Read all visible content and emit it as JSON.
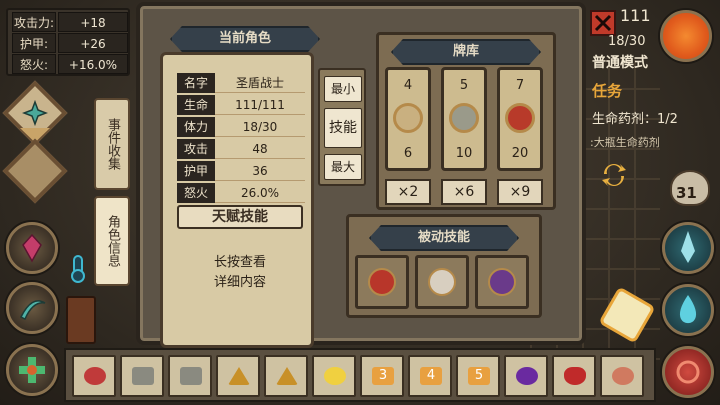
{
  "hud": {
    "attack_label": "攻击力:",
    "attack_value": "+18",
    "armor_label": "护甲:",
    "armor_value": "+26",
    "rage_label": "怒火:",
    "rage_value": "+16.0%"
  },
  "side_tabs": {
    "events": "事件收集",
    "character": "角色信息"
  },
  "panel": {
    "title": "当前角色",
    "attributes": [
      {
        "key": "名字",
        "value": "圣盾战士"
      },
      {
        "key": "生命",
        "value": "111/111"
      },
      {
        "key": "体力",
        "value": "18/30"
      },
      {
        "key": "攻击",
        "value": "48"
      },
      {
        "key": "护甲",
        "value": "36"
      },
      {
        "key": "怒火",
        "value": "26.0%"
      }
    ],
    "talent_button": "天赋技能",
    "hint_line1": "长按查看",
    "hint_line2": "详细内容"
  },
  "sort": {
    "min": "最小",
    "skill": "技能",
    "max": "最大"
  },
  "deck": {
    "title": "牌库",
    "cards": [
      {
        "top": "4",
        "bottom": "6",
        "count": "×2",
        "icon": "fist-icon",
        "color": "#c9b080"
      },
      {
        "top": "5",
        "bottom": "10",
        "count": "×6",
        "icon": "claw-icon",
        "color": "#c9b080"
      },
      {
        "top": "7",
        "bottom": "20",
        "count": "×9",
        "icon": "sword-burst-icon",
        "color": "#b83a2a"
      }
    ]
  },
  "passive": {
    "title": "被动技能",
    "icons": [
      "shield-rank-icon",
      "crossed-swords-icon",
      "demon-mask-icon"
    ]
  },
  "right": {
    "hp_top": "111",
    "stamina_top": "18/30",
    "mode": "普通模式",
    "task_title": "任务",
    "task_text": "生命药剂：1/2",
    "task_sub": ":大瓶生命药剂",
    "gold": "31"
  },
  "items": [
    "red-ore-icon",
    "grey-scroll-icon",
    "grey-scroll-icon",
    "triangle-rune-icon",
    "triangle-rune-icon",
    "lightbulb-icon",
    "card-3-icon",
    "card-4-icon",
    "card-5-icon",
    "purple-orb-icon",
    "red-potion-icon",
    "meat-icon"
  ],
  "item_labels": [
    "",
    "",
    "",
    "",
    "",
    "",
    "3",
    "4",
    "5",
    "",
    "",
    ""
  ],
  "colors": {
    "accent": "#b58a4a",
    "panel": "#5d5447",
    "parchment": "#d8caa5",
    "header": "#35404a"
  }
}
